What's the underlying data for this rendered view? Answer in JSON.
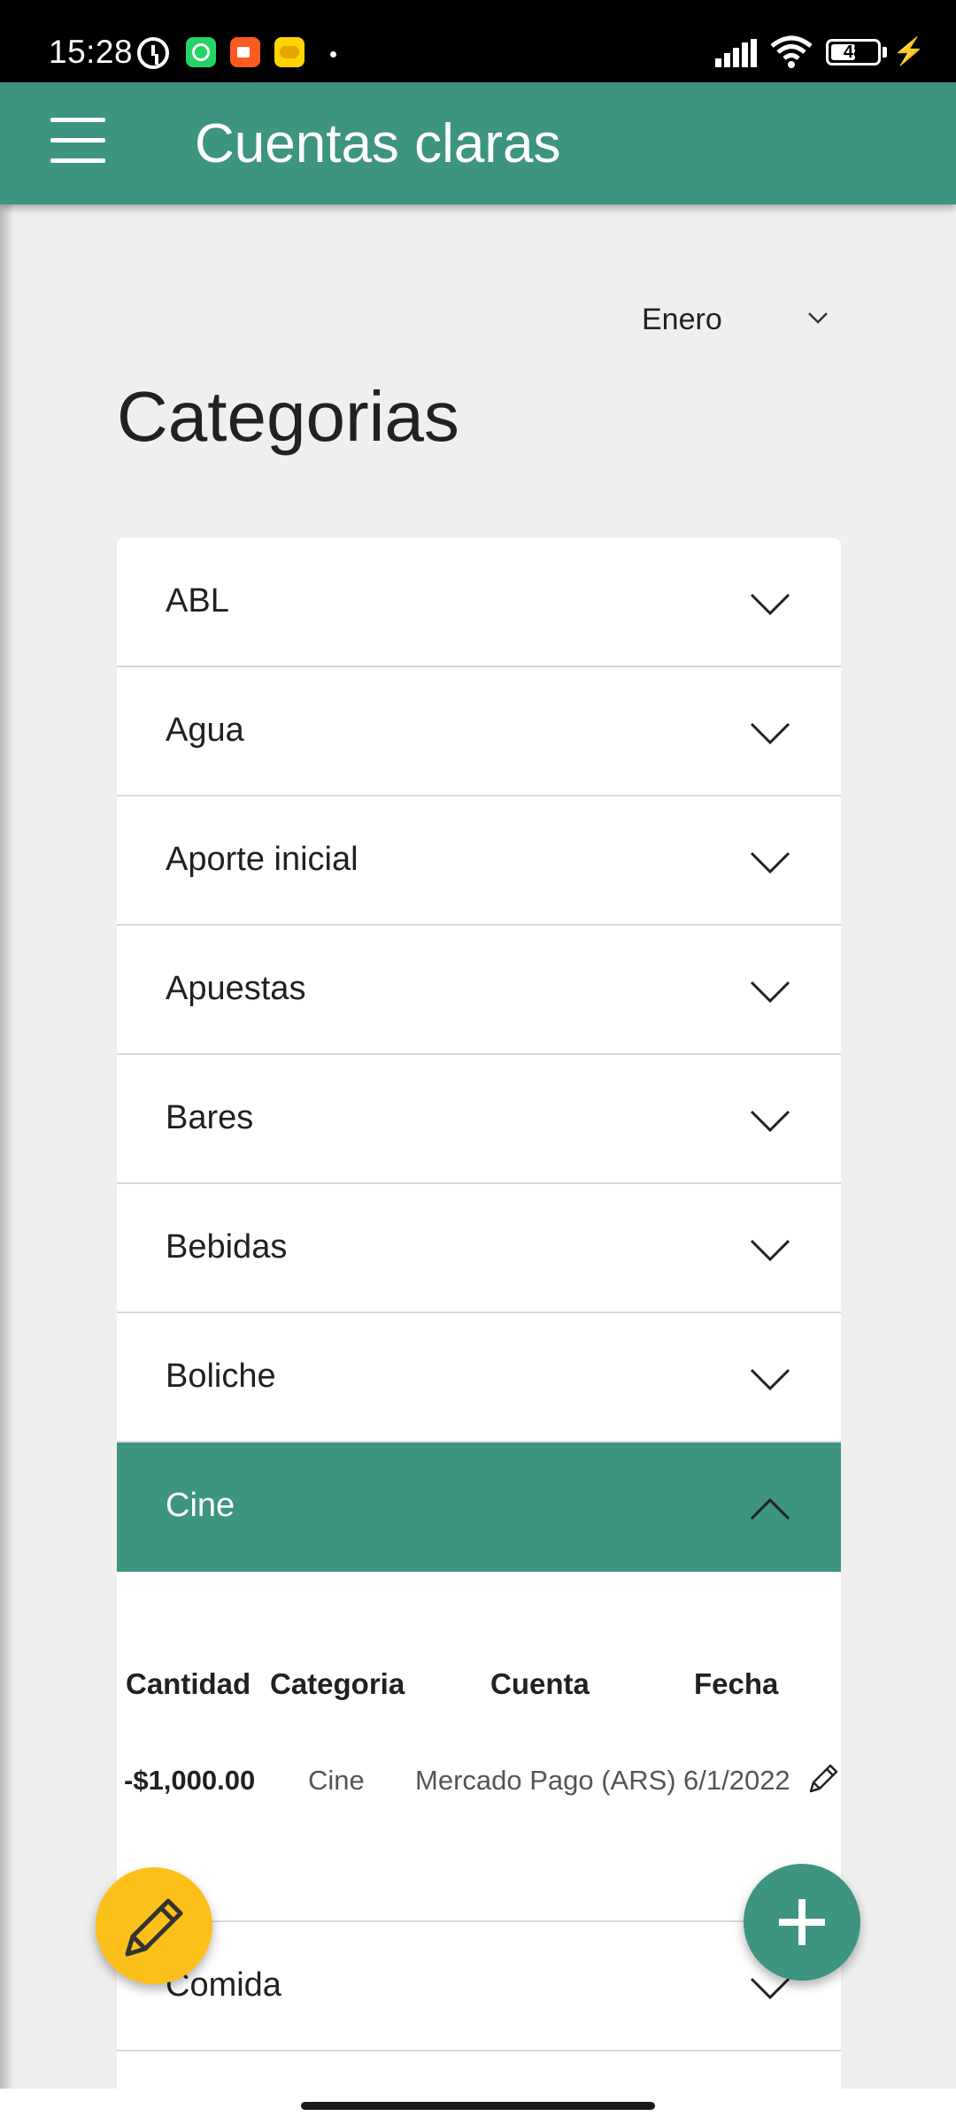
{
  "status_bar": {
    "time": "15:28",
    "battery": "48",
    "icons": [
      "alarm-icon",
      "whatsapp-icon",
      "video-icon",
      "app-icon",
      "signal-icon",
      "wifi-icon",
      "battery-icon",
      "charging-icon"
    ]
  },
  "app_bar": {
    "title": "Cuentas claras",
    "menu_icon": "menu-icon",
    "color": "#3d9481"
  },
  "month_select": {
    "value": "Enero"
  },
  "page_title": "Categorias",
  "categories": [
    {
      "label": "ABL",
      "expanded": false
    },
    {
      "label": "Agua",
      "expanded": false
    },
    {
      "label": "Aporte inicial",
      "expanded": false
    },
    {
      "label": "Apuestas",
      "expanded": false
    },
    {
      "label": "Bares",
      "expanded": false
    },
    {
      "label": "Bebidas",
      "expanded": false
    },
    {
      "label": "Boliche",
      "expanded": false
    },
    {
      "label": "Cine",
      "expanded": true
    },
    {
      "label": "Comida",
      "expanded": false
    }
  ],
  "expanded_table": {
    "headers": [
      "Cantidad",
      "Categoria",
      "Cuenta",
      "Fecha"
    ],
    "rows": [
      {
        "amount": "-$1,000.00",
        "category": "Cine",
        "account": "Mercado Pago (ARS)",
        "date": "6/1/2022",
        "action_icon": "pencil-icon"
      }
    ]
  },
  "fabs": {
    "edit_icon": "pencil-icon",
    "edit_color": "#fbc01a",
    "add_icon": "plus-icon",
    "add_color": "#3d9481"
  }
}
